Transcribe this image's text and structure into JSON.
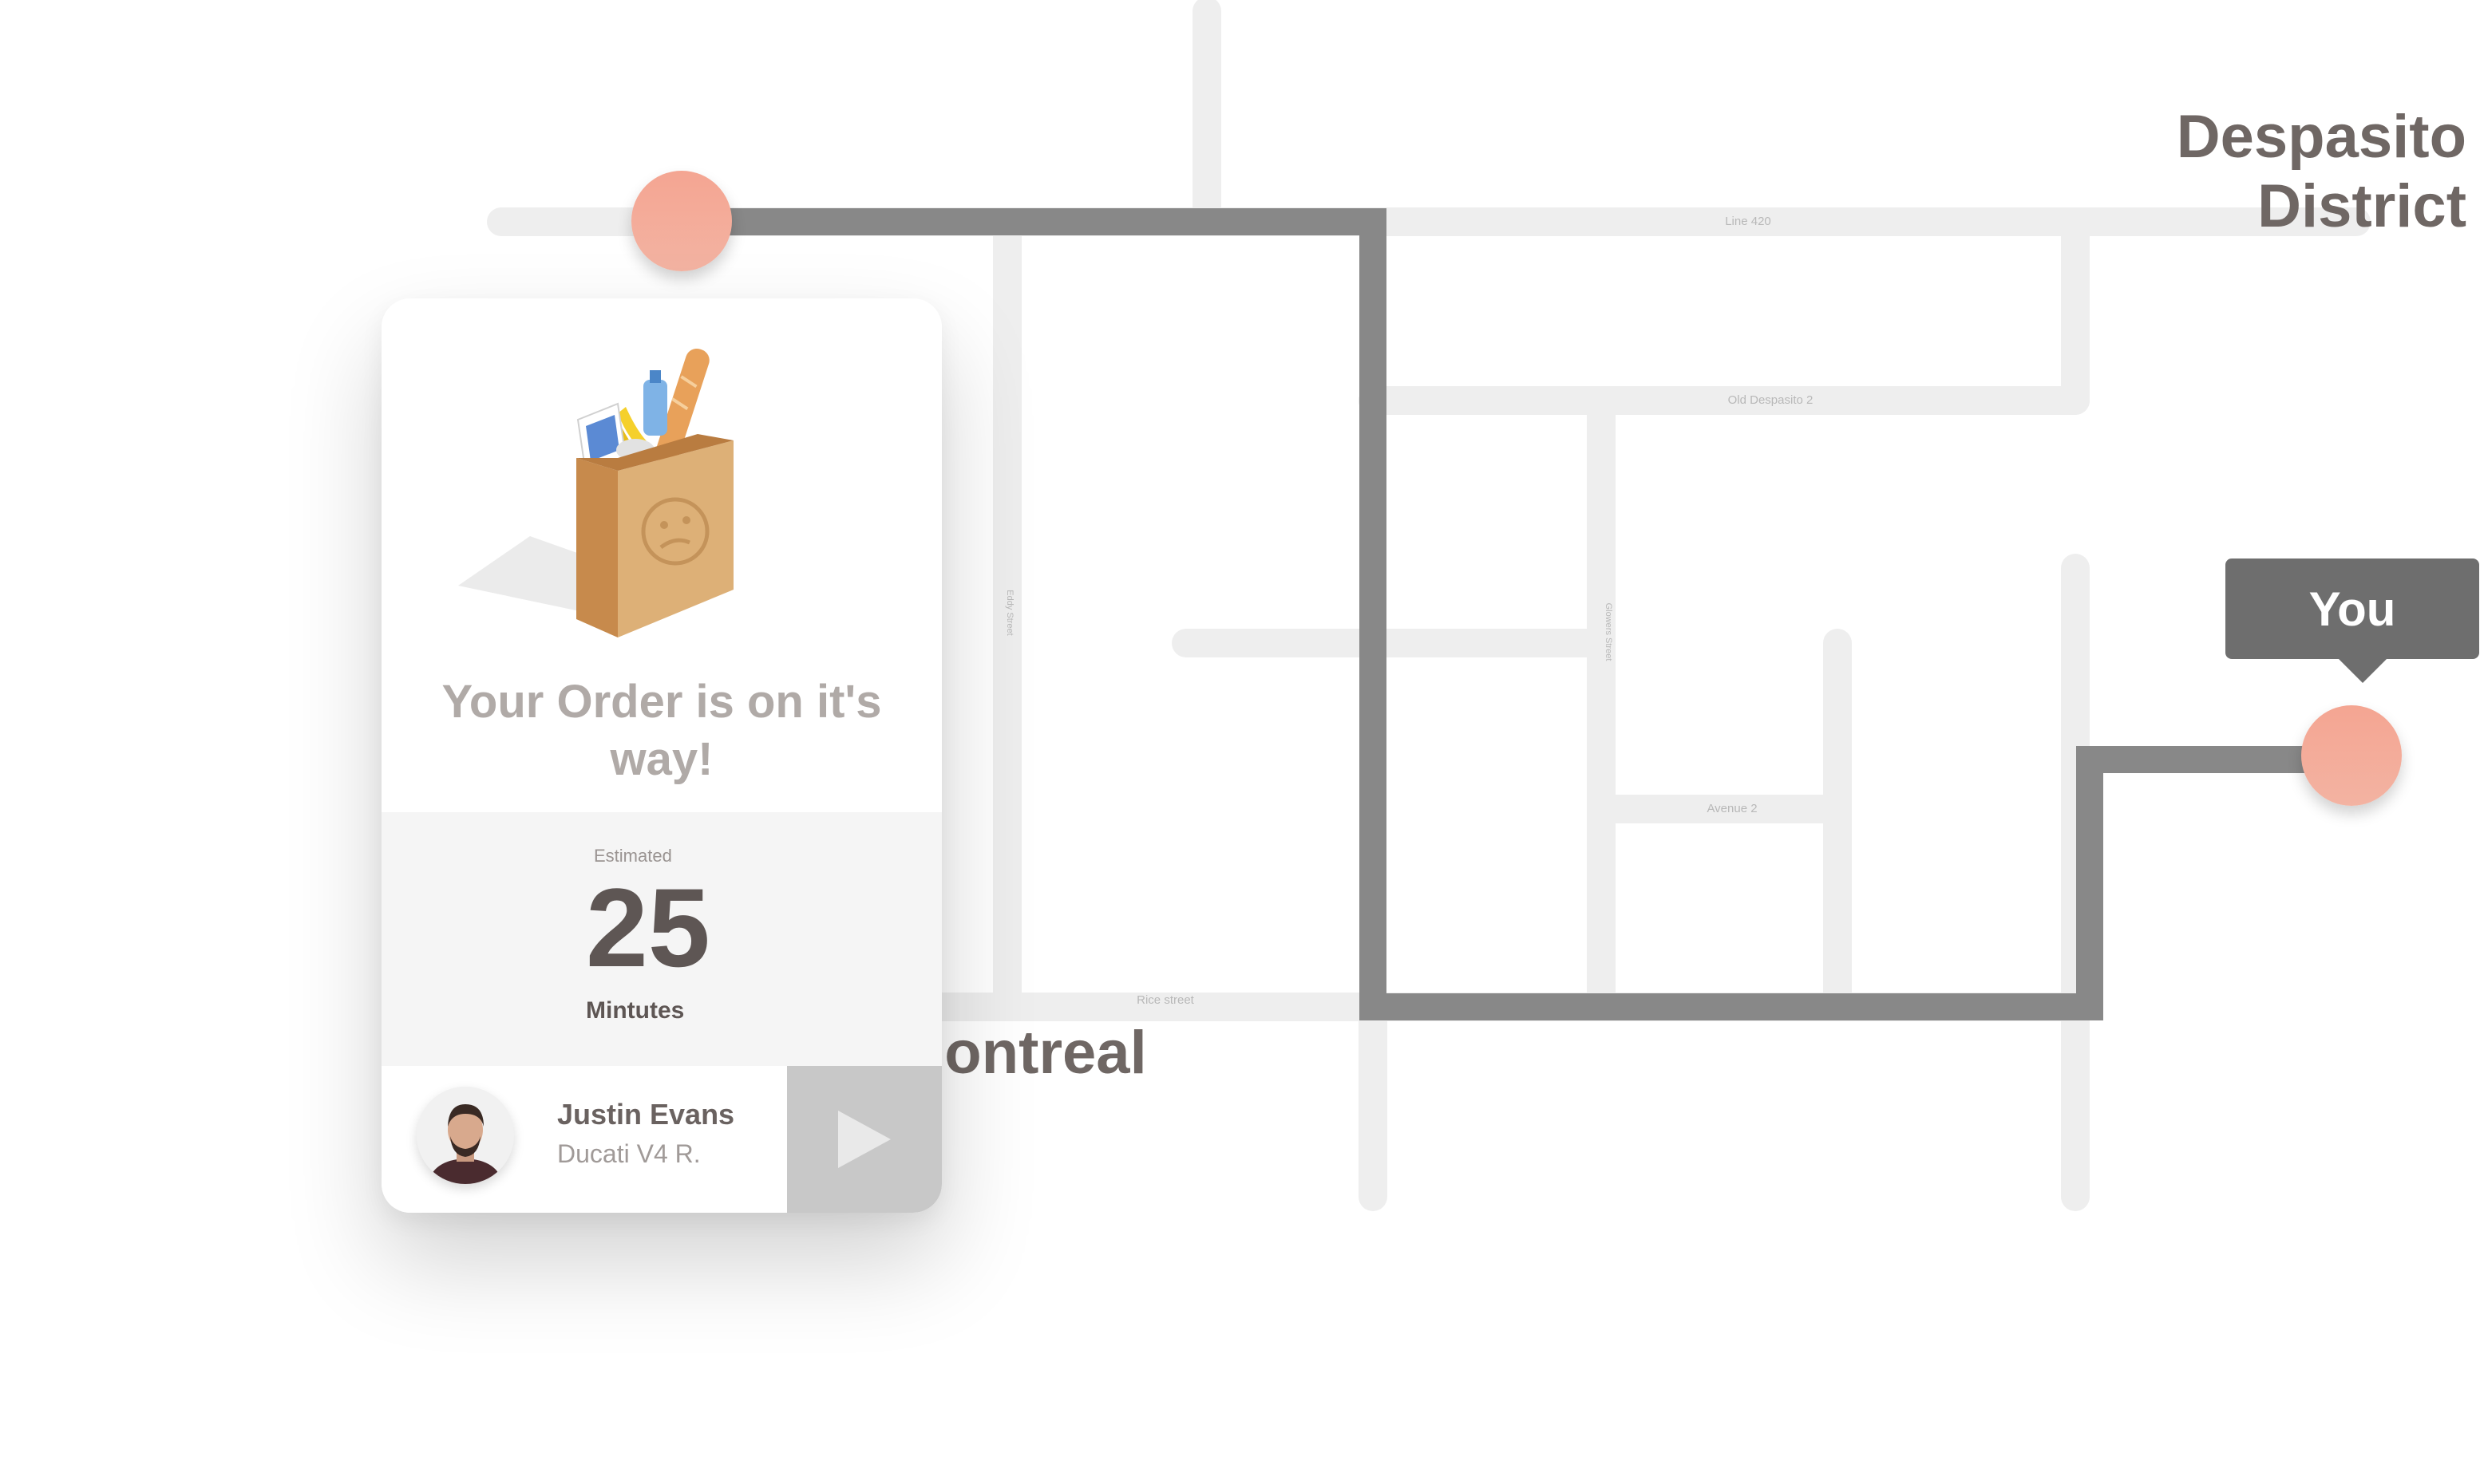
{
  "map": {
    "district_label": "Despasito District",
    "city_label": "Montreal",
    "streets": {
      "line_420": "Line 420",
      "old_despasito_2": "Old Despasito 2",
      "avenue_2": "Avenue 2",
      "rice_street": "Rice street",
      "left_vertical": "Eddy Street",
      "mid_vertical": "Glowers Street"
    },
    "user_tooltip": "You",
    "colors": {
      "road": "#eeeeee",
      "route": "#888888",
      "pin": "#f4a592",
      "tooltip": "#6e6e6e"
    }
  },
  "card": {
    "title": "Your Order is on it's way!",
    "estimate": {
      "label": "Estimated",
      "value": "25",
      "unit": "Mintutes"
    },
    "driver": {
      "name": "Justin Evans",
      "vehicle": "Ducati V4 R."
    },
    "icons": {
      "illustration": "grocery-bag-icon",
      "play": "play-icon",
      "avatar": "driver-avatar"
    }
  }
}
